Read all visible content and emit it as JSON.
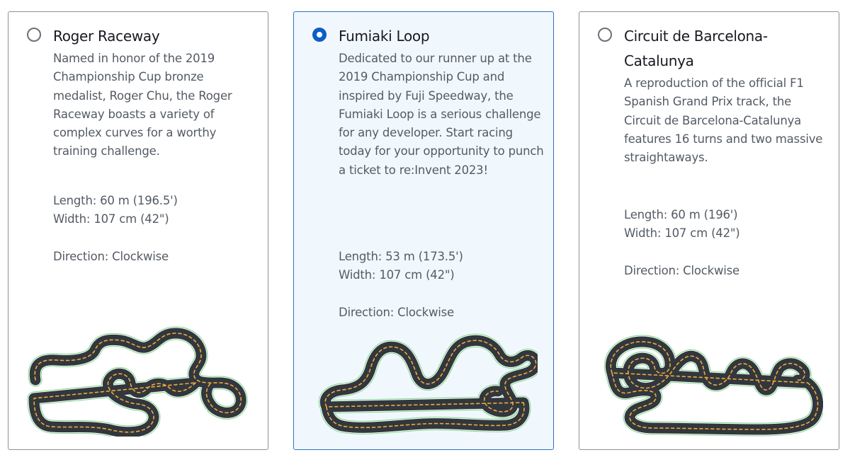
{
  "tracks": [
    {
      "name": "Roger Raceway",
      "selected": false,
      "description": "Named in honor of the 2019 Championship Cup bronze medalist, Roger Chu, the Roger Raceway boasts a variety of complex curves for a worthy training challenge.",
      "length": "Length: 60 m (196.5')",
      "width": "Width: 107 cm (42\")",
      "direction": "Direction: Clockwise"
    },
    {
      "name": "Fumiaki Loop",
      "selected": true,
      "description": "Dedicated to our runner up at the 2019 Championship Cup and inspired by Fuji Speedway, the Fumiaki Loop is a serious challenge for any developer. Start racing today for your opportunity to punch a ticket to re:Invent 2023!",
      "length": "Length: 53 m (173.5')",
      "width": "Width: 107 cm (42\")",
      "direction": "Direction: Clockwise"
    },
    {
      "name": "Circuit de Barcelona-Catalunya",
      "selected": false,
      "description": "A reproduction of the official F1 Spanish Grand Prix track, the Circuit de Barcelona-Catalunya features 16 turns and two massive straightaways.",
      "length": "Length: 60 m (196')",
      "width": "Width: 107 cm (42\")",
      "direction": "Direction: Clockwise"
    }
  ],
  "colors": {
    "selected_border": "#2a72c4",
    "selected_background": "#f1f8fd",
    "radio_checked": "#0c5fc4",
    "track_asphalt": "#31373d",
    "track_center_line": "#f2a93b",
    "track_edge": "#7fd38a"
  }
}
